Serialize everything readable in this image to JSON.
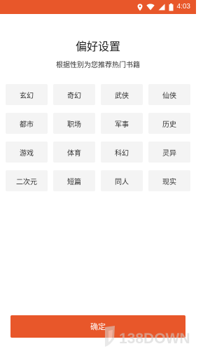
{
  "status_bar": {
    "time": "4:03",
    "icons": [
      "location-icon",
      "wifi-icon",
      "signal-icon",
      "battery-icon"
    ],
    "color": "#e8572a"
  },
  "header": {
    "title": "偏好设置",
    "subtitle": "根据性别为您推荐热门书籍"
  },
  "genres": [
    {
      "label": "玄幻"
    },
    {
      "label": "奇幻"
    },
    {
      "label": "武侠"
    },
    {
      "label": "仙侠"
    },
    {
      "label": "都市"
    },
    {
      "label": "职场"
    },
    {
      "label": "军事"
    },
    {
      "label": "历史"
    },
    {
      "label": "游戏"
    },
    {
      "label": "体育"
    },
    {
      "label": "科幻"
    },
    {
      "label": "灵异"
    },
    {
      "label": "二次元"
    },
    {
      "label": "短篇"
    },
    {
      "label": "同人"
    },
    {
      "label": "现实"
    }
  ],
  "footer": {
    "confirm_label": "确定"
  },
  "watermark": {
    "text": "138DOWN"
  },
  "colors": {
    "accent": "#e8572a",
    "item_bg": "#f4f4f4",
    "text": "#333333"
  }
}
